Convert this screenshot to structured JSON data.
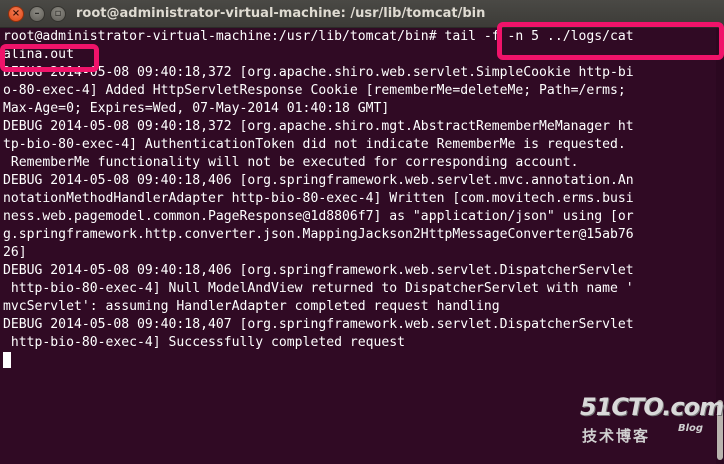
{
  "window": {
    "title": "root@administrator-virtual-machine: /usr/lib/tomcat/bin"
  },
  "terminal": {
    "lines": [
      "root@administrator-virtual-machine:/usr/lib/tomcat/bin# tail -f -n 5 ../logs/cat",
      "alina.out",
      "DEBUG 2014-05-08 09:40:18,372 [org.apache.shiro.web.servlet.SimpleCookie http-bi",
      "o-80-exec-4] Added HttpServletResponse Cookie [rememberMe=deleteMe; Path=/erms;",
      "Max-Age=0; Expires=Wed, 07-May-2014 01:40:18 GMT]",
      "DEBUG 2014-05-08 09:40:18,372 [org.apache.shiro.mgt.AbstractRememberMeManager ht",
      "tp-bio-80-exec-4] AuthenticationToken did not indicate RememberMe is requested.",
      " RememberMe functionality will not be executed for corresponding account.",
      "DEBUG 2014-05-08 09:40:18,406 [org.springframework.web.servlet.mvc.annotation.An",
      "notationMethodHandlerAdapter http-bio-80-exec-4] Written [com.movitech.erms.busi",
      "ness.web.pagemodel.common.PageResponse@1d8806f7] as \"application/json\" using [or",
      "g.springframework.http.converter.json.MappingJackson2HttpMessageConverter@15ab76",
      "26]",
      "DEBUG 2014-05-08 09:40:18,406 [org.springframework.web.servlet.DispatcherServlet",
      " http-bio-80-exec-4] Null ModelAndView returned to DispatcherServlet with name '",
      "mvcServlet': assuming HandlerAdapter completed request handling",
      "DEBUG 2014-05-08 09:40:18,407 [org.springframework.web.servlet.DispatcherServlet",
      " http-bio-80-exec-4] Successfully completed request"
    ]
  },
  "watermark": {
    "logo": "51CTO.com",
    "subtitle": "技术博客",
    "blog": "Blog"
  },
  "colors": {
    "background": "#300a24",
    "text": "#ffffff",
    "highlight": "#f0136a",
    "close_button": "#dd4814"
  }
}
